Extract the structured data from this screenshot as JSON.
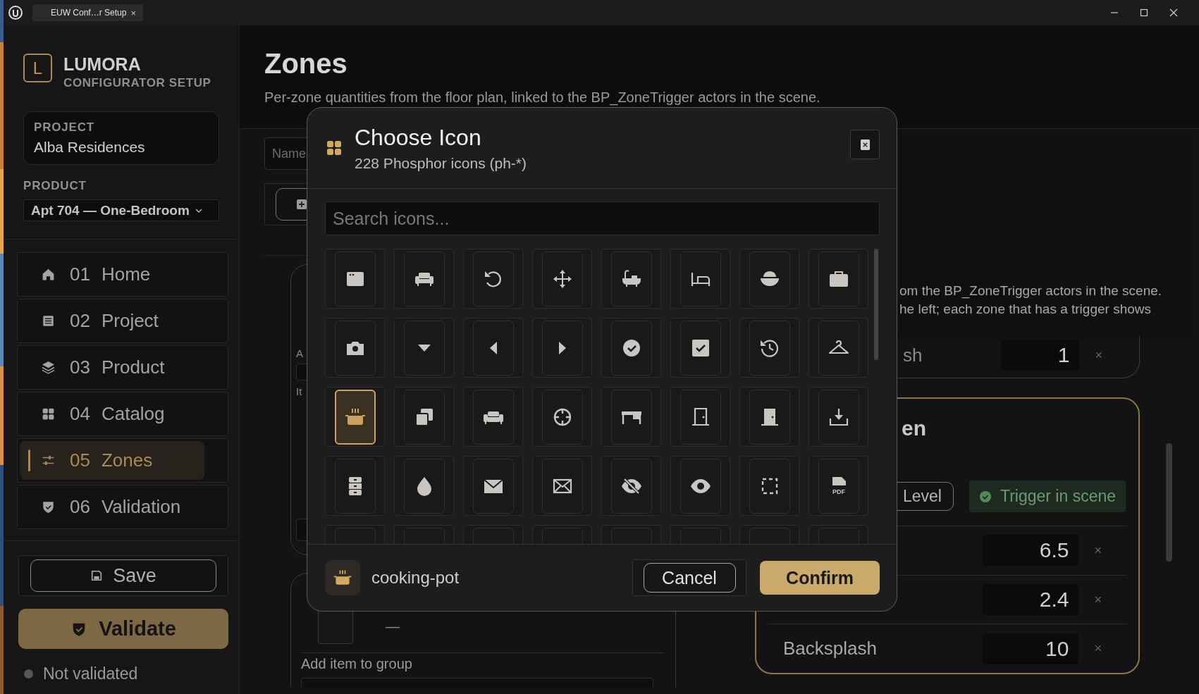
{
  "window": {
    "tab": "EUW Conf…r Setup",
    "tab_close": "×"
  },
  "sidebar": {
    "brand": {
      "logo": "L",
      "name": "LUMORA",
      "tagline": "CONFIGURATOR SETUP"
    },
    "project": {
      "label": "PROJECT",
      "value": "Alba Residences"
    },
    "product": {
      "label": "PRODUCT",
      "value": "Apt 704 — One-Bedroom"
    },
    "nav": [
      {
        "number": "01",
        "label": "Home",
        "kind": "house",
        "selected": false
      },
      {
        "number": "02",
        "label": "Project",
        "kind": "list",
        "selected": false
      },
      {
        "number": "03",
        "label": "Product",
        "kind": "layers",
        "selected": false
      },
      {
        "number": "04",
        "label": "Catalog",
        "kind": "grid",
        "selected": false
      },
      {
        "number": "05",
        "label": "Zones",
        "kind": "sliders",
        "selected": true
      },
      {
        "number": "06",
        "label": "Validation",
        "kind": "shield",
        "selected": false
      }
    ],
    "save": "Save",
    "validate": "Validate",
    "status": {
      "text": "Not validated",
      "validated": false
    }
  },
  "page": {
    "title": "Zones",
    "subtitle": "Per-zone quantities from the floor plan, linked to the BP_ZoneTrigger actors in the scene."
  },
  "background": {
    "name_placeholder": "Name",
    "group_card": {
      "labels": [
        "A",
        "It"
      ]
    },
    "item_card": {
      "dash": "—",
      "add_label": "Add item to group"
    },
    "tooltip": [
      "om the BP_ZoneTrigger actors in the scene.",
      "he left; each zone that has a trigger shows"
    ],
    "upper_zone": {
      "row_label": "sh",
      "value": "1",
      "remove": "×"
    },
    "zone": {
      "title": "en",
      "level_button": "Level",
      "trigger": "Trigger in scene",
      "rows": [
        {
          "value": "6.5",
          "remove": "×"
        },
        {
          "value": "2.4",
          "remove": "×"
        },
        {
          "label": "Backsplash",
          "value": "10",
          "remove": "×"
        }
      ]
    }
  },
  "modal": {
    "title": "Choose Icon",
    "subtitle": "228 Phosphor icons (ph-*)",
    "search_placeholder": "Search icons...",
    "icons": [
      {
        "kind": "app-window",
        "selected": false
      },
      {
        "kind": "armchair",
        "selected": false
      },
      {
        "kind": "rotate-arrow",
        "selected": false
      },
      {
        "kind": "move-arrows",
        "selected": false
      },
      {
        "kind": "bathtub",
        "selected": false
      },
      {
        "kind": "bed",
        "selected": false
      },
      {
        "kind": "bowl",
        "selected": false
      },
      {
        "kind": "briefcase",
        "selected": false
      },
      {
        "kind": "camera",
        "selected": false
      },
      {
        "kind": "caret-down",
        "selected": false
      },
      {
        "kind": "caret-left",
        "selected": false
      },
      {
        "kind": "caret-right",
        "selected": false
      },
      {
        "kind": "check-circle",
        "selected": false
      },
      {
        "kind": "check-square",
        "selected": false
      },
      {
        "kind": "history",
        "selected": false
      },
      {
        "kind": "hanger",
        "selected": false
      },
      {
        "kind": "cooking-pot",
        "selected": true
      },
      {
        "kind": "copy",
        "selected": false
      },
      {
        "kind": "couch",
        "selected": false
      },
      {
        "kind": "crosshair",
        "selected": false
      },
      {
        "kind": "desk",
        "selected": false
      },
      {
        "kind": "door",
        "selected": false
      },
      {
        "kind": "door-filled",
        "selected": false
      },
      {
        "kind": "download",
        "selected": false
      },
      {
        "kind": "drawers",
        "selected": false
      },
      {
        "kind": "drop",
        "selected": false
      },
      {
        "kind": "envelope",
        "selected": false
      },
      {
        "kind": "envelope-cross",
        "selected": false
      },
      {
        "kind": "eye-slash",
        "selected": false
      },
      {
        "kind": "eye",
        "selected": false
      },
      {
        "kind": "selection",
        "selected": false
      },
      {
        "kind": "pdf-file",
        "label": "PDF",
        "selected": false
      },
      {
        "selected": false
      },
      {
        "selected": false
      },
      {
        "selected": false
      },
      {
        "selected": false
      },
      {
        "selected": false
      },
      {
        "selected": false
      },
      {
        "selected": false
      },
      {
        "selected": false
      }
    ],
    "selected_name": "cooking-pot",
    "cancel": "Cancel",
    "confirm": "Confirm"
  }
}
